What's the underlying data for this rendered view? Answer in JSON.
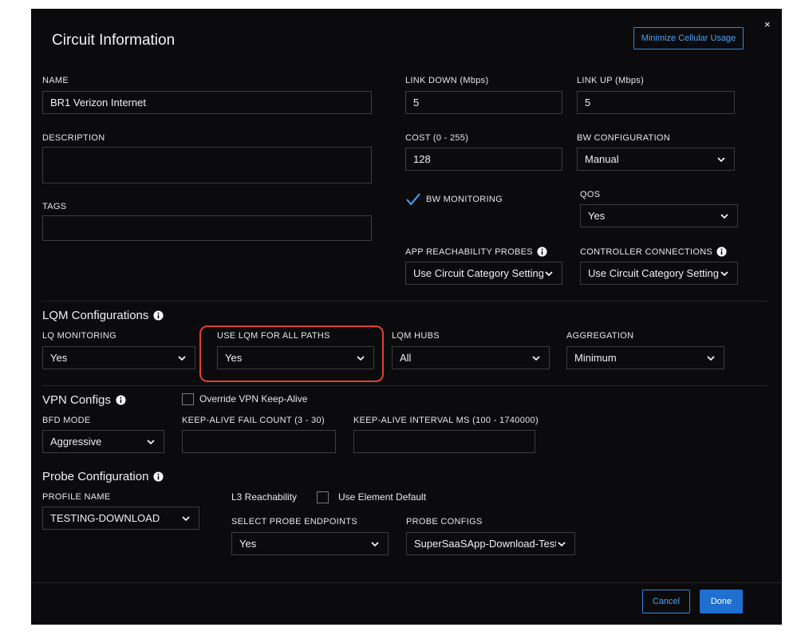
{
  "dialog": {
    "title": "Circuit Information",
    "minimize_button": "Minimize Cellular Usage",
    "close_glyph": "×"
  },
  "circuit": {
    "name": {
      "label": "NAME",
      "value": "BR1 Verizon Internet"
    },
    "description": {
      "label": "DESCRIPTION",
      "value": ""
    },
    "tags": {
      "label": "TAGS",
      "value": ""
    },
    "link_down": {
      "label": "LINK DOWN (Mbps)",
      "value": "5"
    },
    "link_up": {
      "label": "LINK UP (Mbps)",
      "value": "5"
    },
    "cost": {
      "label": "COST (0 - 255)",
      "value": "128"
    },
    "bw_configuration": {
      "label": "BW CONFIGURATION",
      "value": "Manual"
    },
    "bw_monitoring": {
      "label": "BW MONITORING",
      "checked": true
    },
    "qos": {
      "label": "QOS",
      "value": "Yes"
    },
    "app_reachability_probes": {
      "label": "APP REACHABILITY PROBES",
      "value": "Use Circuit Category Setting"
    },
    "controller_connections": {
      "label": "CONTROLLER CONNECTIONS",
      "value": "Use Circuit Category Setting"
    }
  },
  "lqm": {
    "section_title": "LQM Configurations",
    "lq_monitoring": {
      "label": "LQ MONITORING",
      "value": "Yes"
    },
    "use_lqm_for_all_paths": {
      "label": "USE LQM FOR ALL PATHS",
      "value": "Yes",
      "highlighted": true
    },
    "lqm_hubs": {
      "label": "LQM HUBS",
      "value": "All"
    },
    "aggregation": {
      "label": "AGGREGATION",
      "value": "Minimum"
    }
  },
  "vpn": {
    "section_title": "VPN Configs",
    "override_keepalive": {
      "label": "Override VPN Keep-Alive",
      "checked": false
    },
    "bfd_mode": {
      "label": "BFD MODE",
      "value": "Aggressive"
    },
    "keepalive_fail_count": {
      "label": "KEEP-ALIVE FAIL COUNT (3 - 30)",
      "value": ""
    },
    "keepalive_interval": {
      "label": "KEEP-ALIVE INTERVAL MS (100 - 1740000)",
      "value": ""
    }
  },
  "probe": {
    "section_title": "Probe Configuration",
    "profile_name": {
      "label": "PROFILE NAME",
      "value": "TESTING-DOWNLOAD"
    },
    "l3_reachability_label": "L3 Reachability",
    "use_element_default": {
      "label": "Use Element Default",
      "checked": false
    },
    "select_probe_endpoints": {
      "label": "SELECT PROBE ENDPOINTS",
      "value": "Yes"
    },
    "probe_configs": {
      "label": "PROBE CONFIGS",
      "value": "SuperSaaSApp-Download-Test"
    }
  },
  "footer": {
    "cancel_label": "Cancel",
    "done_label": "Done"
  },
  "colors": {
    "background": "#0b0b0d",
    "accent": "#1f6fd1",
    "highlight": "#e0412e",
    "check": "#4aa3f5"
  },
  "icons": [
    "close-icon",
    "info-icon",
    "chevron-down-icon",
    "checkmark-icon"
  ]
}
